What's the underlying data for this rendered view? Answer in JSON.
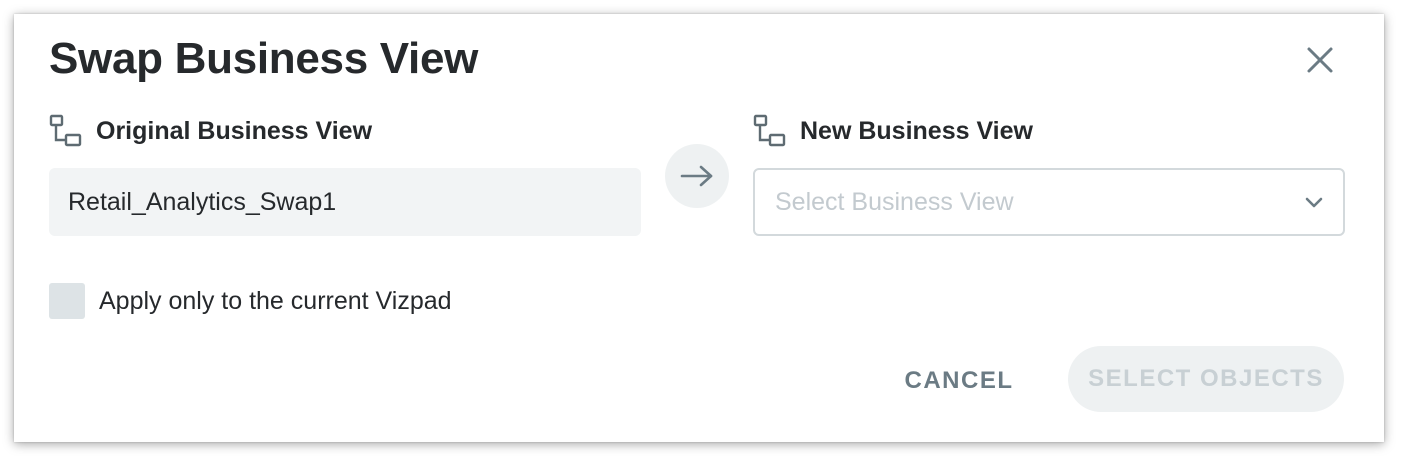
{
  "dialog": {
    "title": "Swap Business View",
    "close_icon": "close-icon"
  },
  "original": {
    "label": "Original Business View",
    "icon": "business-view-icon",
    "value": "Retail_Analytics_Swap1"
  },
  "swap_arrow_icon": "arrow-right-icon",
  "new": {
    "label": "New Business View",
    "icon": "business-view-icon",
    "placeholder": "Select Business View",
    "chevron_icon": "chevron-down-icon"
  },
  "apply_checkbox": {
    "label": "Apply only to the current Vizpad",
    "checked": false
  },
  "actions": {
    "cancel_label": "CANCEL",
    "select_objects_label": "SELECT OBJECTS",
    "select_objects_enabled": false
  },
  "colors": {
    "text": "#26292c",
    "muted": "#6b7b84",
    "input_bg": "#f2f4f5",
    "disabled_text": "#c8d0d4"
  }
}
